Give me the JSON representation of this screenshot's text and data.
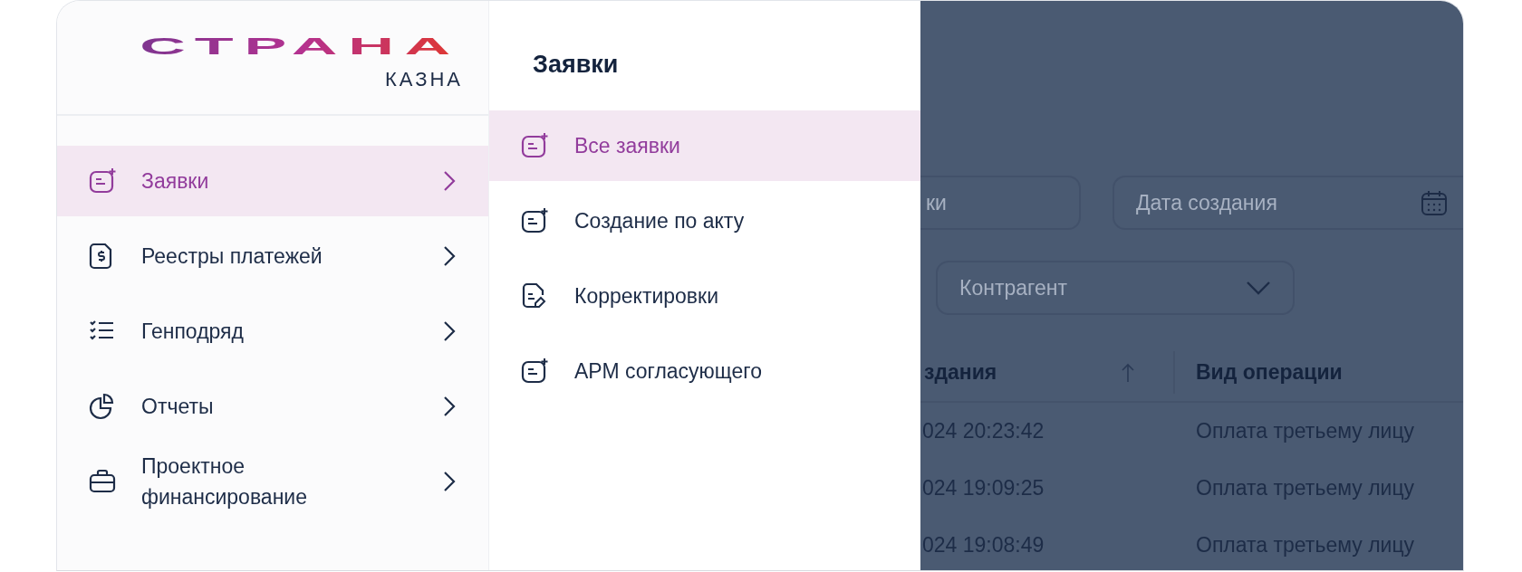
{
  "logo": {
    "wordmark": "СТРАНА",
    "subtitle": "КАЗНА"
  },
  "sidebar": {
    "items": [
      {
        "label": "Заявки",
        "selected": true
      },
      {
        "label": "Реестры платежей",
        "selected": false
      },
      {
        "label": "Генподряд",
        "selected": false
      },
      {
        "label": "Отчеты",
        "selected": false
      },
      {
        "label": "Проектное финансирование",
        "selected": false
      }
    ]
  },
  "submenu": {
    "title": "Заявки",
    "items": [
      {
        "label": "Все заявки",
        "selected": true
      },
      {
        "label": "Создание по акту",
        "selected": false
      },
      {
        "label": "Корректировки",
        "selected": false
      },
      {
        "label": "АРМ согласующего",
        "selected": false
      }
    ]
  },
  "filters": {
    "search": {
      "placeholder": "ки"
    },
    "date": {
      "placeholder": "Дата создания"
    },
    "counterparty": {
      "placeholder": "Контрагент"
    }
  },
  "table": {
    "columns": [
      {
        "label": "здания",
        "sorted_ascending": true
      },
      {
        "label": "Вид операции"
      }
    ],
    "rows": [
      [
        "024 20:23:42",
        "Оплата третьему лицу"
      ],
      [
        "024 19:09:25",
        "Оплата третьему лицу"
      ],
      [
        "024 19:08:49",
        "Оплата третьему лицу"
      ]
    ]
  }
}
